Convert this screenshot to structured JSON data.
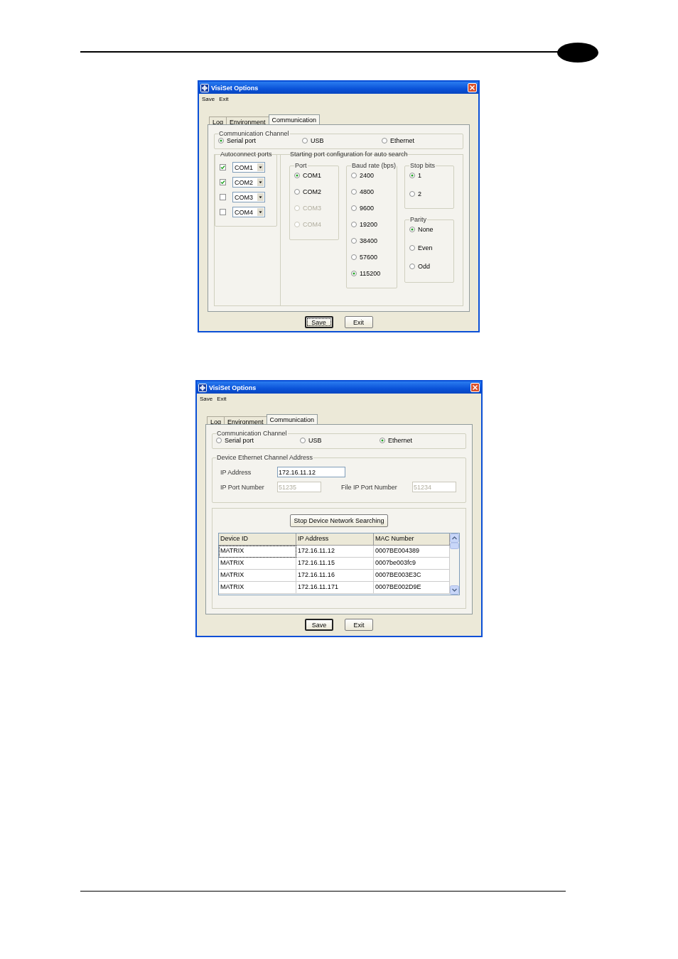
{
  "dialogs": [
    {
      "kind": "serial",
      "title": "VisiSet Options",
      "menu": [
        "Save",
        "Exit"
      ],
      "tabs": [
        {
          "label": "Log",
          "selected": false
        },
        {
          "label": "Environment",
          "selected": false
        },
        {
          "label": "Communication",
          "selected": true
        }
      ],
      "channel": {
        "legend": "Communication Channel",
        "options": [
          {
            "label": "Serial port",
            "selected": true
          },
          {
            "label": "USB",
            "selected": false
          },
          {
            "label": "Ethernet",
            "selected": false
          }
        ]
      },
      "autoconnect": {
        "legend": "Autoconnect ports",
        "ports": [
          {
            "checked": true,
            "value": "COM1"
          },
          {
            "checked": true,
            "value": "COM2"
          },
          {
            "checked": false,
            "value": "COM3"
          },
          {
            "checked": false,
            "value": "COM4"
          }
        ]
      },
      "port_config": {
        "legend": "Starting port configuration for auto search",
        "columns": [
          [
            {
              "legend": "Port",
              "options": [
                {
                  "label": "COM1",
                  "selected": true,
                  "disabled": false
                },
                {
                  "label": "COM2",
                  "selected": false,
                  "disabled": false
                },
                {
                  "label": "COM3",
                  "selected": false,
                  "disabled": true
                },
                {
                  "label": "COM4",
                  "selected": false,
                  "disabled": true
                }
              ]
            }
          ],
          [
            {
              "legend": "Baud rate (bps)",
              "options": [
                {
                  "label": "2400",
                  "selected": false
                },
                {
                  "label": "4800",
                  "selected": false
                },
                {
                  "label": "9600",
                  "selected": false
                },
                {
                  "label": "19200",
                  "selected": false
                },
                {
                  "label": "38400",
                  "selected": false
                },
                {
                  "label": "57600",
                  "selected": false
                },
                {
                  "label": "115200",
                  "selected": true
                }
              ]
            }
          ],
          [
            {
              "legend": "Stop bits",
              "options": [
                {
                  "label": "1",
                  "selected": true
                },
                {
                  "label": "2",
                  "selected": false
                }
              ]
            },
            {
              "legend": "Parity",
              "options": [
                {
                  "label": "None",
                  "selected": true
                },
                {
                  "label": "Even",
                  "selected": false
                },
                {
                  "label": "Odd",
                  "selected": false
                }
              ]
            }
          ]
        ]
      },
      "buttons": [
        {
          "label": "Save",
          "default": true,
          "focused": true
        },
        {
          "label": "Exit",
          "default": false,
          "focused": false
        }
      ]
    },
    {
      "kind": "ethernet",
      "title": "VisiSet Options",
      "menu": [
        "Save",
        "Exit"
      ],
      "tabs": [
        {
          "label": "Log",
          "selected": false
        },
        {
          "label": "Environment",
          "selected": false
        },
        {
          "label": "Communication",
          "selected": true
        }
      ],
      "channel": {
        "legend": "Communication Channel",
        "options": [
          {
            "label": "Serial port",
            "selected": false
          },
          {
            "label": "USB",
            "selected": false
          },
          {
            "label": "Ethernet",
            "selected": true
          }
        ]
      },
      "address": {
        "legend": "Device Ethernet Channel Address",
        "fields": [
          {
            "label": "IP Address",
            "value": "172.16.11.12",
            "disabled": false
          },
          {
            "label": "IP Port Number",
            "value": "51235",
            "disabled": true
          },
          {
            "label": "File IP Port Number",
            "value": "51234",
            "disabled": true
          }
        ]
      },
      "search_button": "Stop Device Network Searching",
      "table": {
        "columns": [
          "Device ID",
          "IP Address",
          "MAC Number"
        ],
        "rows": [
          {
            "cells": [
              "MATRIX",
              "172.16.11.12",
              "0007BE004389"
            ],
            "focused": true
          },
          {
            "cells": [
              "MATRIX",
              "172.16.11.15",
              "0007be003fc9"
            ],
            "focused": false
          },
          {
            "cells": [
              "MATRIX",
              "172.16.11.16",
              "0007BE003E3C"
            ],
            "focused": false
          },
          {
            "cells": [
              "MATRIX",
              "172.16.11.171",
              "0007BE002D9E"
            ],
            "focused": false
          }
        ]
      },
      "buttons": [
        {
          "label": "Save",
          "default": true,
          "focused": false
        },
        {
          "label": "Exit",
          "default": false,
          "focused": false
        }
      ]
    }
  ]
}
